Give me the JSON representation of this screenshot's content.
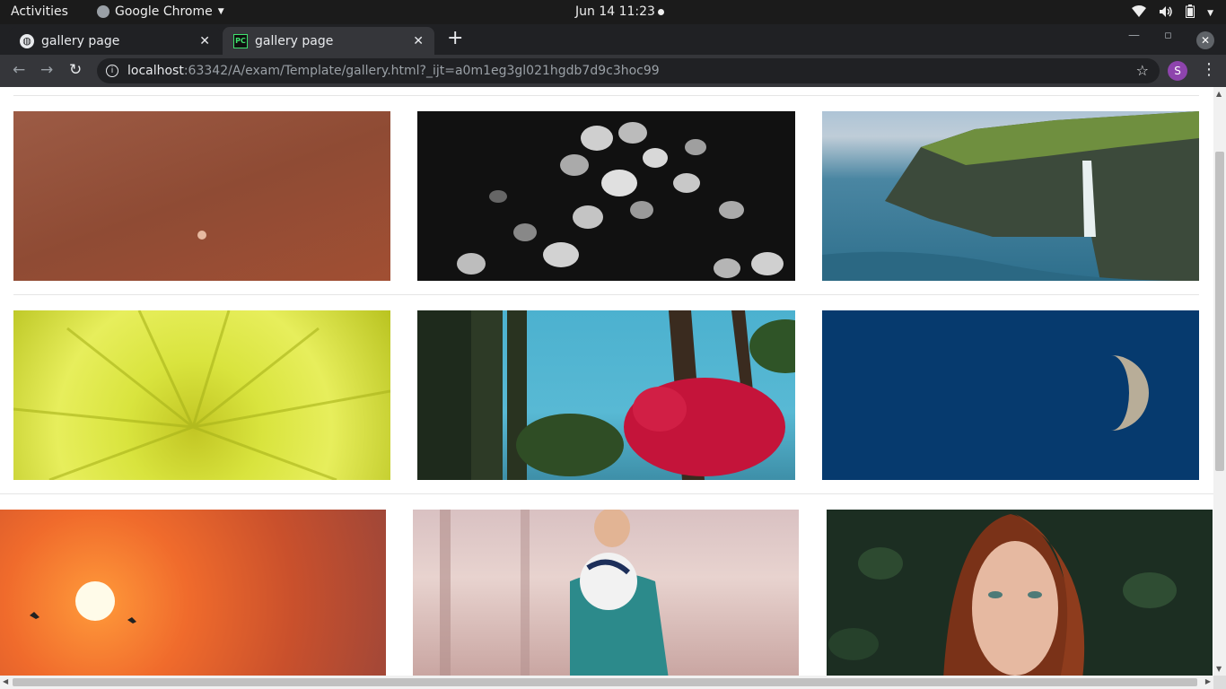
{
  "system_bar": {
    "activities": "Activities",
    "app_name": "Google Chrome",
    "clock": "Jun 14  11:23"
  },
  "tabs": [
    {
      "title": "gallery page",
      "favicon": "globe-icon",
      "active": false
    },
    {
      "title": "gallery page",
      "favicon": "pycharm-icon",
      "active": true
    }
  ],
  "toolbar": {
    "url_host": "localhost",
    "url_path": ":63342/A/exam/Template/gallery.html?_ijt=a0m1eg3gl021hgdb7d9c3hoc99",
    "profile_initial": "S"
  },
  "gallery": {
    "rows": [
      [
        {
          "name": "photo-red-planet",
          "subject": "small planet on rust-colored sky"
        },
        {
          "name": "photo-lily-pads",
          "subject": "black and white lily pads"
        },
        {
          "name": "photo-sea-cliff-waterfall",
          "subject": "sea cliff with waterfall"
        }
      ],
      [
        {
          "name": "photo-yellow-flower",
          "subject": "yellow chrysanthemum macro"
        },
        {
          "name": "photo-palms-bougainvillea",
          "subject": "palm trees with red flowers"
        },
        {
          "name": "photo-moon",
          "subject": "half moon on deep blue sky"
        }
      ],
      [
        {
          "name": "photo-sunset-birds",
          "subject": "orange sunset with birds"
        },
        {
          "name": "photo-boy-with-ball",
          "subject": "boy holding soccer ball"
        },
        {
          "name": "photo-red-haired-woman",
          "subject": "red haired woman among leaves"
        }
      ]
    ]
  },
  "colors": {
    "topbar": "#1b1b1b",
    "tabstrip": "#202124",
    "toolbar": "#35363a",
    "avatar": "#8e44ad"
  }
}
